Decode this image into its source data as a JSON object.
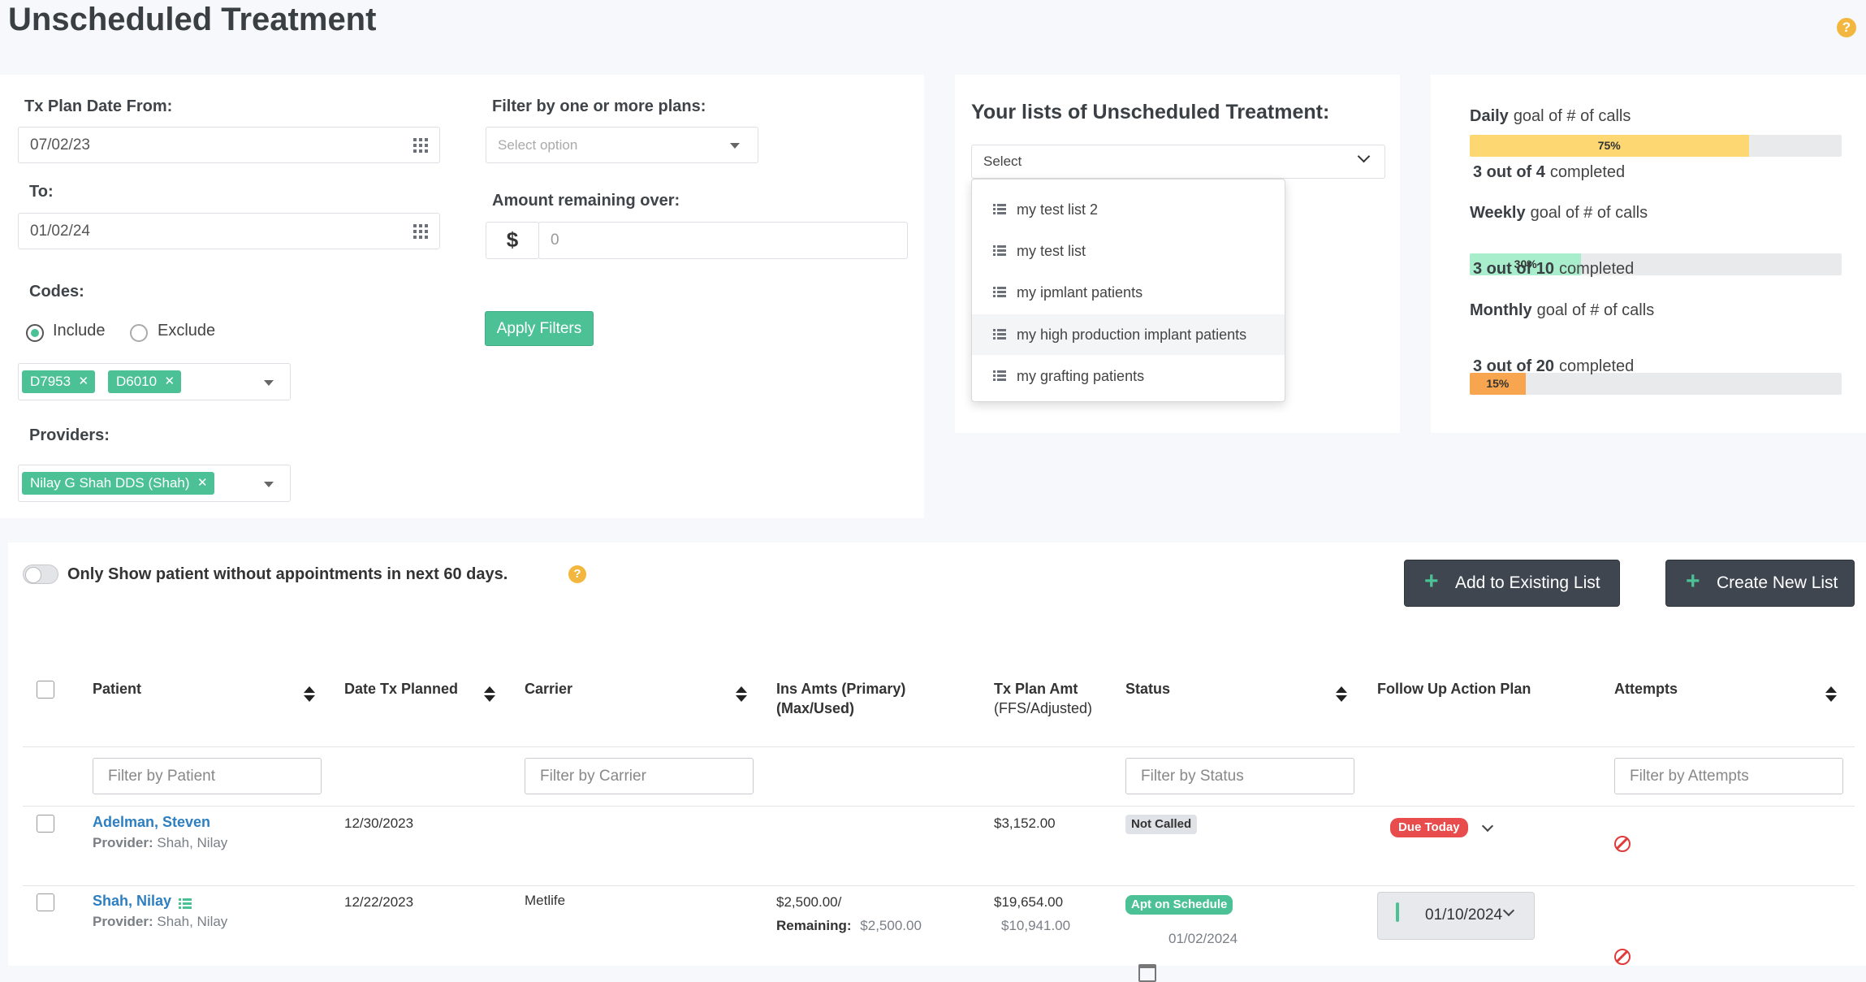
{
  "page": {
    "title": "Unscheduled Treatment",
    "help": "?"
  },
  "filters": {
    "date_from_label": "Tx Plan Date From:",
    "date_from_value": "07/02/23",
    "date_to_label": "To:",
    "date_to_value": "01/02/24",
    "codes_label": "Codes:",
    "include_label": "Include",
    "exclude_label": "Exclude",
    "codes": [
      "D7953",
      "D6010"
    ],
    "providers_label": "Providers:",
    "providers": [
      "Nilay G Shah DDS (Shah)"
    ],
    "plans_label": "Filter by one or more plans:",
    "plans_placeholder": "Select option",
    "amount_label": "Amount remaining over:",
    "amount_prefix": "$",
    "amount_placeholder": "0",
    "apply_label": "Apply Filters"
  },
  "lists": {
    "heading": "Your lists of Unscheduled Treatment:",
    "select_label": "Select",
    "items": [
      "my test list 2",
      "my test list",
      "my ipmlant patients",
      "my high production implant patients",
      "my grafting patients"
    ]
  },
  "goals": [
    {
      "period": "Daily",
      "suffix": "goal of # of calls",
      "percent_label": "75%",
      "fraction": 0.75,
      "color": "#fcd772",
      "count": "3 out of 4",
      "completed": "completed"
    },
    {
      "period": "Weekly",
      "suffix": "goal of # of calls",
      "percent_label": "30%",
      "fraction": 0.3,
      "color": "#a8edcc",
      "count": "3 out of 10",
      "completed": "completed"
    },
    {
      "period": "Monthly",
      "suffix": "goal of # of calls",
      "percent_label": "15%",
      "fraction": 0.15,
      "color": "#f8a54f",
      "count": "3 out of 20",
      "completed": "completed"
    }
  ],
  "toolbar": {
    "toggle_label": "Only Show patient without appointments in next 60 days.",
    "help": "?",
    "add_existing": "Add to Existing List",
    "create_new": "Create New List"
  },
  "table": {
    "headers": {
      "patient": "Patient",
      "date": "Date Tx Planned",
      "carrier": "Carrier",
      "ins_line1": "Ins Amts (Primary)",
      "ins_line2": "(Max/Used)",
      "txamt_line1": "Tx Plan Amt",
      "txamt_line2": "(FFS/Adjusted)",
      "status": "Status",
      "followup": "Follow Up Action Plan",
      "attempts": "Attempts"
    },
    "filters": {
      "patient": "Filter by Patient",
      "carrier": "Filter by Carrier",
      "status": "Filter by Status",
      "attempts": "Filter by Attempts"
    },
    "provider_label": "Provider:",
    "rows": [
      {
        "name": "Adelman, Steven",
        "provider": "Shah, Nilay",
        "date": "12/30/2023",
        "carrier": "",
        "ins": "",
        "remaining_label": "",
        "remaining": "",
        "amt": "$3,152.00",
        "amt2": "",
        "status": "Not Called",
        "status_color": "#dfe2e6",
        "followup_badge": "Due Today",
        "followup_date": "",
        "appt_date": ""
      },
      {
        "name": "Shah, Nilay",
        "provider": "Shah, Nilay",
        "date": "12/22/2023",
        "carrier": "Metlife",
        "ins": "$2,500.00/",
        "remaining_label": "Remaining:",
        "remaining": "$2,500.00",
        "amt": "$19,654.00",
        "amt2": "$10,941.00",
        "status": "Apt on Schedule",
        "status_color": "#4cc195",
        "followup_badge": "",
        "followup_date": "01/10/2024",
        "appt_date": "01/02/2024"
      }
    ]
  }
}
